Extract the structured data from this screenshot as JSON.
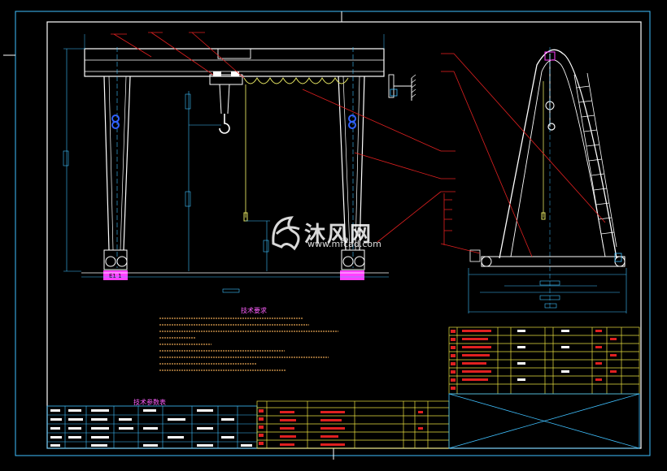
{
  "watermark": {
    "brand": "沐风网",
    "url": "www.mfcad.com"
  },
  "drawing": {
    "tech_requirements_title": "技术要求",
    "tech_params_title": "技术参数表",
    "left_tag": "E1 1",
    "colors": {
      "frame": "#ffffff",
      "dim_blue": "#3fc0ff",
      "leader_red": "#e02020",
      "table_yellow": "#e8e040",
      "text_orange": "#e0a050",
      "magenta": "#ff40ff",
      "hook_yellow": "#e0e060"
    }
  }
}
